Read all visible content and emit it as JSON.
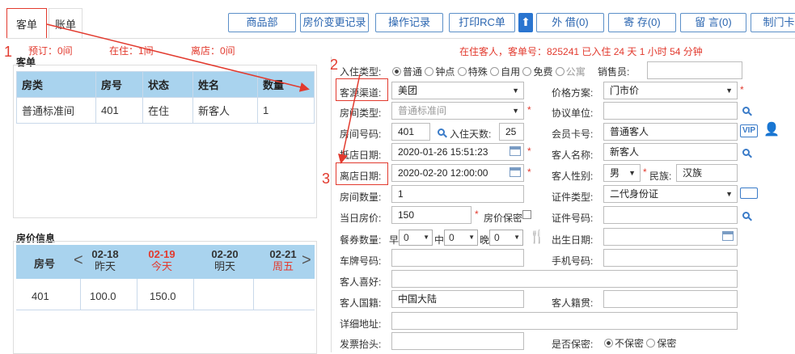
{
  "tabs": {
    "order": "客单",
    "bill": "账单"
  },
  "toolbar": {
    "dept": "商品部",
    "price_change": "房价变更记录",
    "op_log": "操作记录",
    "print_rc": "打印RC单",
    "lend": "外 借(0)",
    "deposit": "寄 存(0)",
    "message": "留 言(0)",
    "card": "制门卡"
  },
  "summary": {
    "reserve": "预订：0间",
    "staying": "在住：1间",
    "left": "离店：0间"
  },
  "status_line": "在住客人，客单号：825241 已入住 24 天 1 小时 54 分钟",
  "order_panel": {
    "title": "客单",
    "headers": [
      "房类",
      "房号",
      "状态",
      "姓名",
      "数量"
    ],
    "rows": [
      [
        "普通标准间",
        "401",
        "在住",
        "新客人",
        "1"
      ]
    ]
  },
  "price_panel": {
    "title": "房价信息",
    "room_header": "房号",
    "days": [
      {
        "date": "02-18",
        "label": "昨天"
      },
      {
        "date": "02-19",
        "label": "今天"
      },
      {
        "date": "02-20",
        "label": "明天"
      },
      {
        "date": "02-21",
        "label": "周五"
      }
    ],
    "rows": [
      {
        "room": "401",
        "prices": [
          "100.0",
          "150.0",
          "",
          ""
        ]
      }
    ]
  },
  "form": {
    "stay_type_label": "入住类型:",
    "stay_types": [
      "普通",
      "钟点",
      "特殊",
      "自用",
      "免费",
      "公寓"
    ],
    "salesman_label": "销售员:",
    "channel_label": "客源渠道:",
    "channel_value": "美团",
    "price_plan_label": "价格方案:",
    "price_plan_value": "门市价",
    "room_type_label": "房间类型:",
    "room_type_value": "普通标准间",
    "agreement_label": "协议单位:",
    "room_no_label": "房间号码:",
    "room_no_value": "401",
    "days_label": "入住天数:",
    "days_value": "25",
    "member_label": "会员卡号:",
    "member_value": "普通客人",
    "arrive_label": "抵店日期:",
    "arrive_value": "2020-01-26 15:51:23",
    "guest_name_label": "客人名称:",
    "guest_name_value": "新客人",
    "depart_label": "离店日期:",
    "depart_value": "2020-02-20 12:00:00",
    "gender_label": "客人性别:",
    "gender_value": "男",
    "ethnic_label": "民族:",
    "ethnic_value": "汉族",
    "room_count_label": "房间数量:",
    "room_count_value": "1",
    "id_type_label": "证件类型:",
    "id_type_value": "二代身份证",
    "day_price_label": "当日房价:",
    "day_price_value": "150",
    "price_secret_label": "房价保密",
    "id_no_label": "证件号码:",
    "meal_label": "餐券数量:",
    "breakfast": "早",
    "lunch": "中",
    "dinner": "晚",
    "meal_values": [
      "0",
      "0",
      "0"
    ],
    "birth_label": "出生日期:",
    "plate_label": "车牌号码:",
    "phone_label": "手机号码:",
    "hobby_label": "客人喜好:",
    "nationality_label": "客人国籍:",
    "nationality_value": "中国大陆",
    "native_label": "客人籍贯:",
    "address_label": "详细地址:",
    "invoice_label": "发票抬头:",
    "secret_label": "是否保密:",
    "secret_options": [
      "不保密",
      "保密"
    ]
  },
  "annotations": [
    "1",
    "2",
    "3"
  ],
  "colors": {
    "accent": "#e23a2e",
    "header_bg": "#a9d3ee",
    "blue": "#2a65b0"
  }
}
